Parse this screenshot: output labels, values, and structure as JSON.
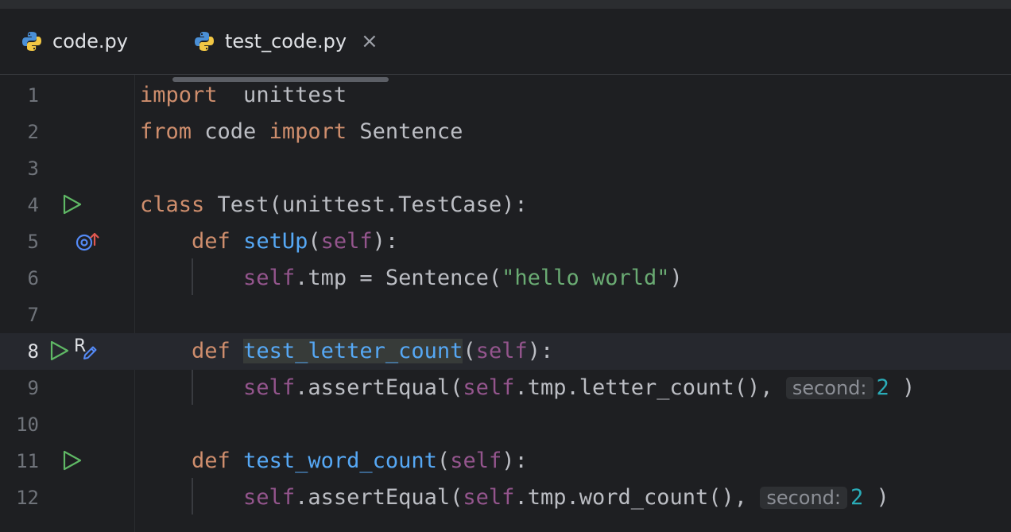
{
  "tabs": [
    {
      "label": "code.py",
      "icon": "python-icon",
      "active": false
    },
    {
      "label": "test_code.py",
      "icon": "python-icon",
      "active": true,
      "close": "×"
    }
  ],
  "gutter": {
    "line_numbers": [
      "1",
      "2",
      "3",
      "4",
      "5",
      "6",
      "7",
      "8",
      "9",
      "10",
      "11",
      "12"
    ],
    "run_icon": "run-triangle-icon",
    "override_icon": "override-up-icon",
    "recent_change_label": "R"
  },
  "code": {
    "l1": {
      "kw": "import",
      "rest": "  unittest"
    },
    "l2": {
      "kw1": "from",
      "mod": " code ",
      "kw2": "import",
      "rest": " Sentence"
    },
    "l4": {
      "kw": "class",
      "rest": " Test(unittest.TestCase):"
    },
    "l5": {
      "kw": "def",
      "fn": "setUp",
      "p1": "(",
      "self": "self",
      "p2": "):"
    },
    "l6": {
      "self": "self",
      "rest": ".tmp = Sentence(",
      "str": "\"hello world\"",
      "end": ")"
    },
    "l8": {
      "kw": "def",
      "fn": "test_letter_count",
      "p1": "(",
      "self": "self",
      "p2": "):"
    },
    "l9": {
      "self1": "self",
      "mid": ".assertEqual(",
      "self2": "self",
      "rest": ".tmp.letter_count(),",
      "hint": "second:",
      "num": "2",
      "end": " )"
    },
    "l11": {
      "kw": "def",
      "fn": "test_word_count",
      "p1": "(",
      "self": "self",
      "p2": "):"
    },
    "l12": {
      "self1": "self",
      "mid": ".assertEqual(",
      "self2": "self",
      "rest": ".tmp.word_count(),",
      "hint": "second:",
      "num": "2",
      "end": " )"
    }
  },
  "colors": {
    "background": "#1e1f22",
    "keyword": "#cf8e6d",
    "function": "#56a8f5",
    "self": "#94558d",
    "string": "#6aab73",
    "number": "#2aacb8",
    "run_icon": "#5fb865"
  }
}
